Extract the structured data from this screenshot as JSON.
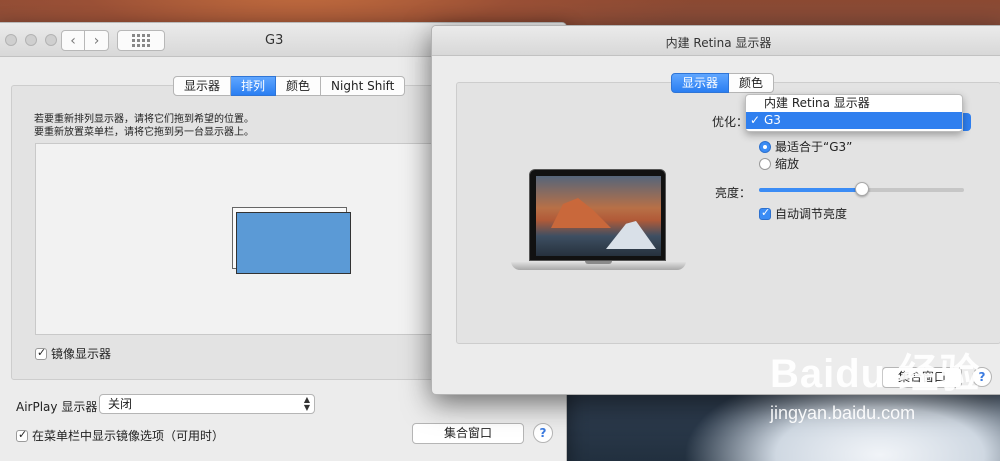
{
  "back_window": {
    "title": "G3",
    "tabs": [
      "显示器",
      "排列",
      "颜色",
      "Night Shift"
    ],
    "active_tab": 1,
    "hint_line1": "若要重新排列显示器，请将它们拖到希望的位置。",
    "hint_line2": "要重新放置菜单栏，请将它拖到另一台显示器上。",
    "mirror_label": "镜像显示器",
    "mirror_checked": true,
    "airplay_label": "AirPlay 显示器：",
    "airplay_value": "关闭",
    "menubar_option_label": "在菜单栏中显示镜像选项（可用时）",
    "menubar_option_checked": true,
    "gather_windows": "集合窗口",
    "help": "?"
  },
  "front_window": {
    "title": "内建 Retina 显示器",
    "tabs": [
      "显示器",
      "颜色"
    ],
    "active_tab": 0,
    "optimize_label": "优化：",
    "optimize_menu": [
      {
        "label": "内建 Retina 显示器",
        "selected": false
      },
      {
        "label": "G3",
        "selected": true
      }
    ],
    "checkmark": "✓",
    "resolution_options": [
      {
        "label": "最适合于“G3”",
        "selected": true
      },
      {
        "label": "缩放",
        "selected": false
      }
    ],
    "brightness_label": "亮度：",
    "brightness_level": 0.5,
    "auto_brightness_label": "自动调节亮度",
    "auto_brightness_checked": true,
    "gather_windows": "集合窗口",
    "help": "?"
  },
  "watermark": {
    "brand": "Baidu 经验",
    "url": "jingyan.baidu.com"
  },
  "icons": {
    "back": "‹",
    "forward": "›",
    "select_arrows": "▲▼"
  }
}
